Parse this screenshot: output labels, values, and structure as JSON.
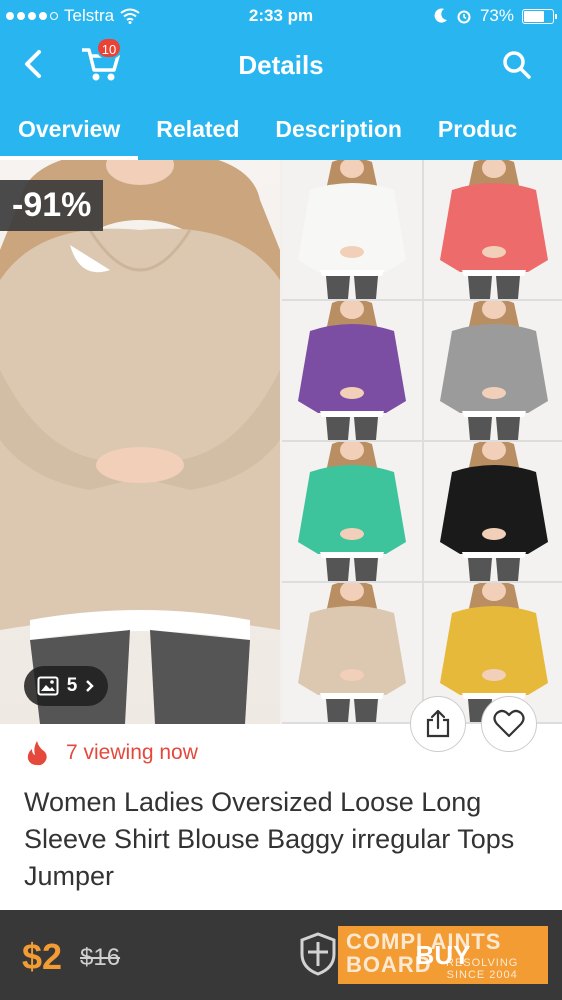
{
  "status_bar": {
    "carrier": "Telstra",
    "time": "2:33 pm",
    "battery": "73%",
    "battery_level": 0.73
  },
  "nav": {
    "title": "Details",
    "cart_count": "10"
  },
  "tabs": [
    "Overview",
    "Related",
    "Description",
    "Produc"
  ],
  "gallery": {
    "discount": "-91%",
    "photo_count": "5",
    "thumbnail_colors": [
      "#f7f7f5",
      "#ee6b6c",
      "#7b4ea3",
      "#9b9b9b",
      "#3dc49c",
      "#1a1a1a",
      "#dcc8b0",
      "#e7b93a"
    ]
  },
  "product": {
    "viewing": "7 viewing now",
    "title": "Women Ladies Oversized Loose Long Sleeve Shirt Blouse Baggy irregular Tops Jumper"
  },
  "bottom": {
    "price": "$2",
    "old_price": "$16",
    "buy_label": "BUY"
  },
  "watermark": {
    "line1": "COMPLAINTS",
    "line2": "BOARD",
    "sub1": "RESOLVING",
    "sub2": "SINCE 2004"
  },
  "colors": {
    "header": "#29b6f0",
    "accent_orange": "#f39c33",
    "fire_red": "#e4493c",
    "bottom_bar": "#383838"
  }
}
